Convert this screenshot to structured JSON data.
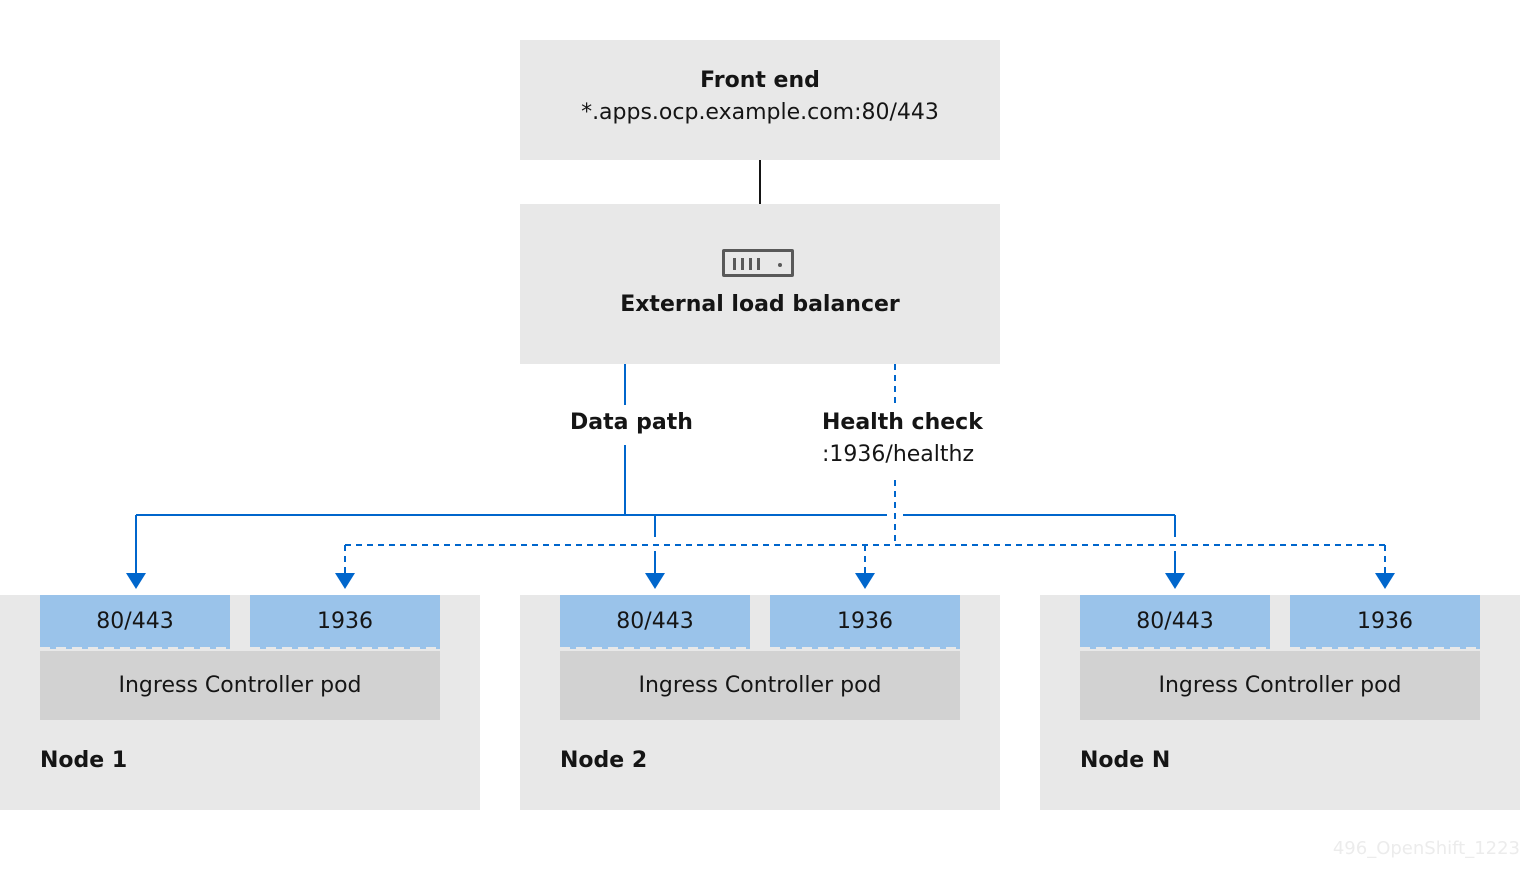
{
  "front_end": {
    "title": "Front end",
    "address": "*.apps.ocp.example.com:80/443"
  },
  "load_balancer": {
    "title": "External load balancer",
    "icon": "server-rack-icon"
  },
  "paths": {
    "data_path": {
      "label": "Data path"
    },
    "health_check": {
      "label": "Health check",
      "endpoint": ":1936/healthz"
    }
  },
  "nodes": [
    {
      "label": "Node 1",
      "ports": [
        "80/443",
        "1936"
      ],
      "pod": "Ingress Controller pod"
    },
    {
      "label": "Node 2",
      "ports": [
        "80/443",
        "1936"
      ],
      "pod": "Ingress Controller pod"
    },
    {
      "label": "Node N",
      "ports": [
        "80/443",
        "1936"
      ],
      "pod": "Ingress Controller pod"
    }
  ],
  "colors": {
    "connector": "#0066cc",
    "port": "#9ac3ea",
    "pod": "#d2d2d2",
    "container": "#e8e8e8"
  },
  "watermark": "496_OpenShift_1223"
}
